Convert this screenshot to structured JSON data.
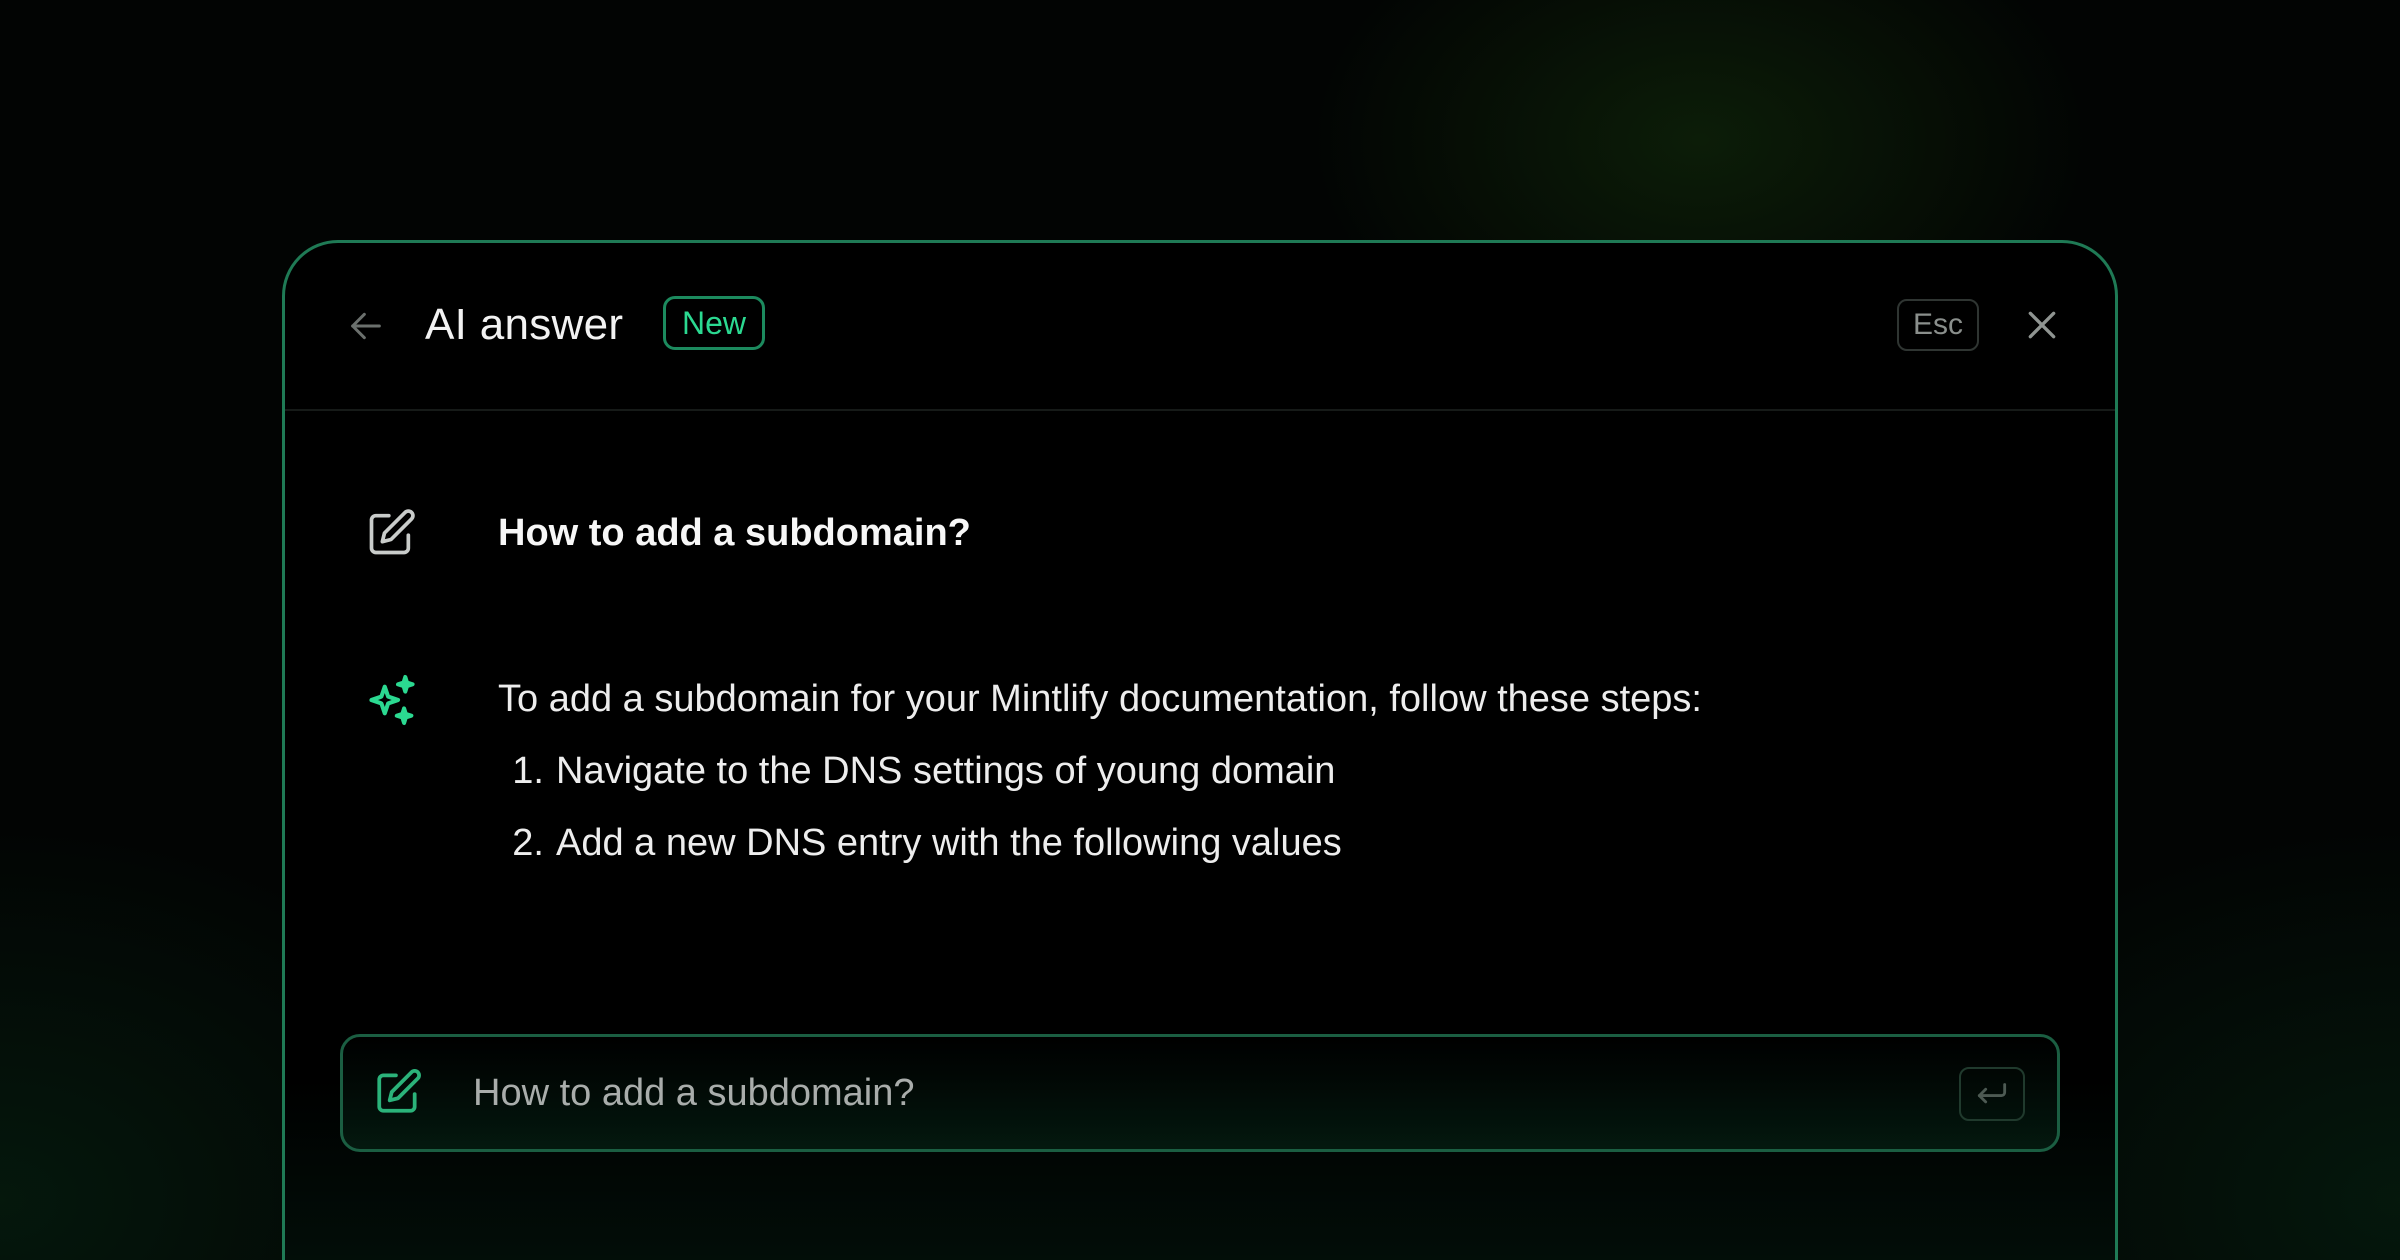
{
  "header": {
    "title": "AI answer",
    "badge": "New",
    "esc_label": "Esc"
  },
  "question": {
    "text": "How to add a subdomain?"
  },
  "answer": {
    "intro": "To add a subdomain for your Mintlify documentation, follow these steps:",
    "steps": [
      {
        "number": "1.",
        "text": "Navigate to the DNS settings of young domain"
      },
      {
        "number": "2.",
        "text": "Add a new DNS entry with the following values"
      }
    ]
  },
  "input": {
    "text": "How to add a subdomain?"
  },
  "icons": {
    "back": "arrow-left-icon",
    "close": "close-icon",
    "question": "edit-icon",
    "answer": "sparkles-icon",
    "input": "edit-icon",
    "enter": "enter-key-icon"
  },
  "colors": {
    "accent": "#2bd991",
    "panel_border": "#1f7a55",
    "background": "#000000"
  }
}
